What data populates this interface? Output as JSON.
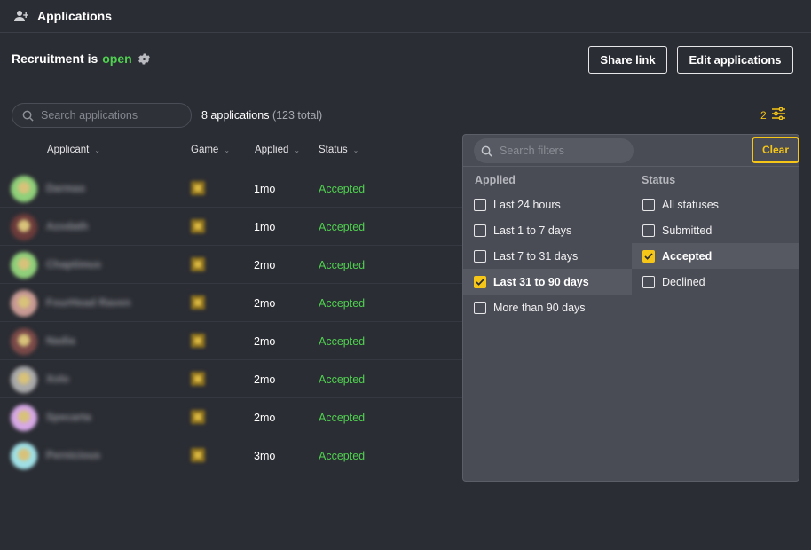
{
  "header": {
    "title": "Applications",
    "icon": "user-add-icon"
  },
  "recruitment": {
    "prefix": "Recruitment is",
    "state": "open"
  },
  "actions": {
    "share_label": "Share link",
    "edit_label": "Edit applications"
  },
  "search": {
    "placeholder": "Search applications",
    "value": ""
  },
  "summary": {
    "shown": "8 applications",
    "total": "(123 total)"
  },
  "filter_toggle": {
    "count": "2"
  },
  "table": {
    "columns": [
      "Applicant",
      "Game",
      "Applied",
      "Status"
    ],
    "rows": [
      {
        "name": "Darmas",
        "applied": "1mo",
        "status": "Accepted",
        "avatar_color": "#8fd07a"
      },
      {
        "name": "Azodath",
        "applied": "1mo",
        "status": "Accepted",
        "avatar_color": "#6b3b3a"
      },
      {
        "name": "Chaptimus",
        "applied": "2mo",
        "status": "Accepted",
        "avatar_color": "#8fd07a"
      },
      {
        "name": "FourHead Raven",
        "applied": "2mo",
        "status": "Accepted",
        "avatar_color": "#c89a94"
      },
      {
        "name": "Nadia",
        "applied": "2mo",
        "status": "Accepted",
        "avatar_color": "#7a4948"
      },
      {
        "name": "Xolo",
        "applied": "2mo",
        "status": "Accepted",
        "avatar_color": "#a9a9aa"
      },
      {
        "name": "Specarta",
        "applied": "2mo",
        "status": "Accepted",
        "avatar_color": "#d6a8e6"
      },
      {
        "name": "Pernicious",
        "applied": "3mo",
        "status": "Accepted",
        "avatar_color": "#9fe0e6"
      }
    ]
  },
  "filters": {
    "search_placeholder": "Search filters",
    "clear_label": "Clear",
    "applied": {
      "title": "Applied",
      "options": [
        {
          "label": "Last 24 hours",
          "checked": false
        },
        {
          "label": "Last 1 to 7 days",
          "checked": false
        },
        {
          "label": "Last 7 to 31 days",
          "checked": false
        },
        {
          "label": "Last 31 to 90 days",
          "checked": true
        },
        {
          "label": "More than 90 days",
          "checked": false
        }
      ]
    },
    "status": {
      "title": "Status",
      "options": [
        {
          "label": "All statuses",
          "checked": false
        },
        {
          "label": "Submitted",
          "checked": false
        },
        {
          "label": "Accepted",
          "checked": true
        },
        {
          "label": "Declined",
          "checked": false
        }
      ]
    }
  },
  "colors": {
    "accent": "#f5c518",
    "accepted": "#4fd14f",
    "background": "#2b2d34",
    "panel": "#4a4c55"
  }
}
